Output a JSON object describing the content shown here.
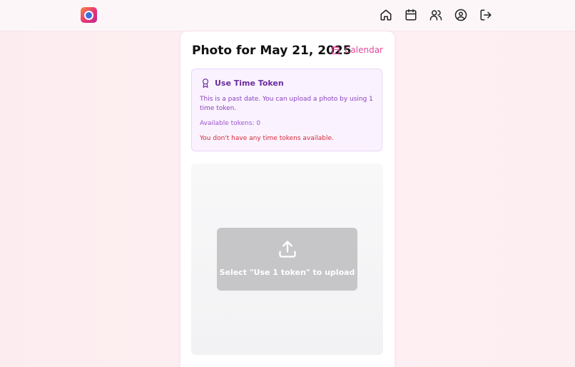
{
  "nav": {
    "logo_icon": "camera-logo",
    "icons": [
      "home-icon",
      "calendar-icon",
      "friends-icon",
      "profile-icon",
      "logout-icon"
    ]
  },
  "header": {
    "title": "Photo for May 21, 2025",
    "calendar_label": "Calendar"
  },
  "token_panel": {
    "title": "Use Time Token",
    "description": "This is a past date. You can upload a photo by using 1 time token.",
    "available": "Available tokens: 0",
    "error": "You don't have any time tokens available."
  },
  "upload": {
    "button_label": "Select \"Use 1 token\" to upload"
  },
  "colors": {
    "accent": "#e3489a",
    "token_bg": "#faf3ff",
    "token_text": "#6b2c9e",
    "error": "#d42a3a",
    "upload_button": "#c6c6c8"
  }
}
